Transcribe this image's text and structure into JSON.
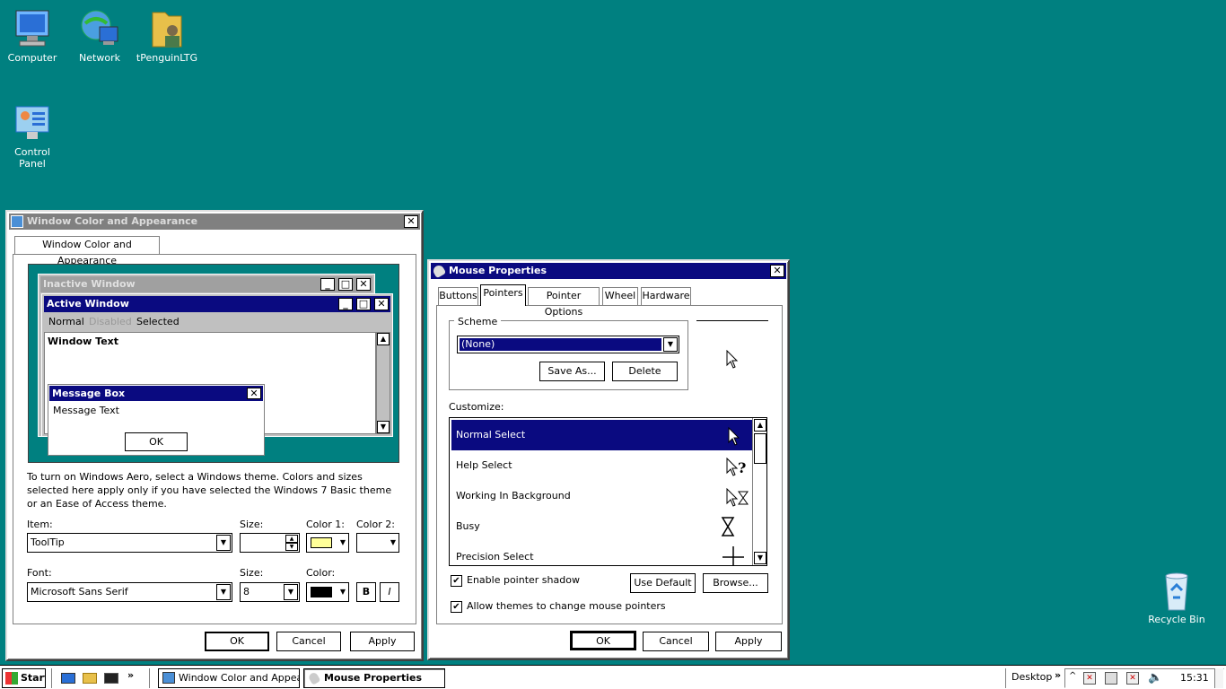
{
  "desktop": {
    "icons": [
      {
        "label": "Computer",
        "icon": "computer-icon"
      },
      {
        "label": "Network",
        "icon": "network-icon"
      },
      {
        "label": "tPenguinLTG",
        "icon": "user-folder-icon"
      },
      {
        "label": "Control Panel",
        "icon": "control-panel-icon"
      },
      {
        "label": "Recycle Bin",
        "icon": "recycle-bin-icon"
      }
    ]
  },
  "appearance": {
    "title": "Window Color and Appearance",
    "tab": "Window Color and Appearance",
    "preview": {
      "inactive_title": "Inactive Window",
      "active_title": "Active Window",
      "menu_normal": "Normal",
      "menu_disabled": "Disabled",
      "menu_selected": "Selected",
      "window_text": "Window Text",
      "msgbox_title": "Message Box",
      "msgbox_text": "Message Text",
      "msgbox_ok": "OK"
    },
    "info": "To turn on Windows Aero, select a Windows theme.  Colors and sizes selected here apply only if you have selected the Windows 7 Basic theme or an Ease of Access theme.",
    "item_label": "Item:",
    "item_value": "ToolTip",
    "size_label": "Size:",
    "size_value": "",
    "color1_label": "Color 1:",
    "color1": "#ffff99",
    "color2_label": "Color 2:",
    "font_label": "Font:",
    "font_value": "Microsoft Sans Serif",
    "fsize_label": "Size:",
    "fsize_value": "8",
    "color_label": "Color:",
    "font_color": "#000000",
    "bold": "B",
    "italic": "I",
    "ok": "OK",
    "cancel": "Cancel",
    "apply": "Apply"
  },
  "mouse": {
    "title": "Mouse Properties",
    "tabs": [
      "Buttons",
      "Pointers",
      "Pointer Options",
      "Wheel",
      "Hardware"
    ],
    "active_tab": "Pointers",
    "scheme_label": "Scheme",
    "scheme_value": "(None)",
    "save_as": "Save As...",
    "delete": "Delete",
    "customize_label": "Customize:",
    "pointers": [
      {
        "name": "Normal Select",
        "icon": "arrow-pointer-icon"
      },
      {
        "name": "Help Select",
        "icon": "help-pointer-icon"
      },
      {
        "name": "Working In Background",
        "icon": "working-pointer-icon"
      },
      {
        "name": "Busy",
        "icon": "hourglass-icon"
      },
      {
        "name": "Precision Select",
        "icon": "crosshair-icon"
      }
    ],
    "shadow_label": "Enable pointer shadow",
    "shadow_checked": true,
    "themes_label": "Allow themes to change mouse pointers",
    "themes_checked": true,
    "use_default": "Use Default",
    "browse": "Browse...",
    "ok": "OK",
    "cancel": "Cancel",
    "apply": "Apply"
  },
  "taskbar": {
    "start": "Start",
    "tasks": [
      "Window Color and Appea...",
      "Mouse Properties"
    ],
    "desktop_label": "Desktop",
    "chevron": "»",
    "clock": "15:31"
  }
}
